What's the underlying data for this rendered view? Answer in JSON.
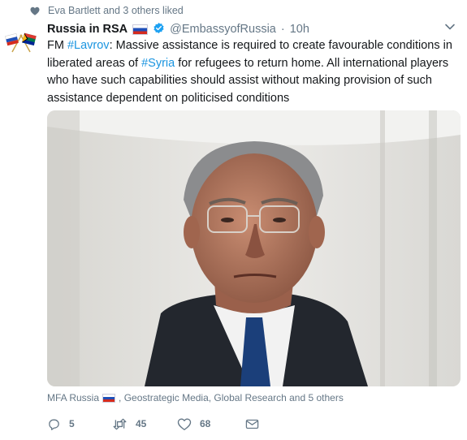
{
  "social_context": {
    "text": "Eva Bartlett and 3 others liked"
  },
  "tweet": {
    "display_name": "Russia in RSA",
    "handle": "@EmbassyofRussia",
    "separator": "·",
    "time": "10h",
    "text_parts": [
      {
        "text": "FM ",
        "type": "plain"
      },
      {
        "text": "#Lavrov",
        "type": "hashtag"
      },
      {
        "text": ": Massive assistance is required to create favourable conditions in liberated areas of ",
        "type": "plain"
      },
      {
        "text": "#Syria",
        "type": "hashtag"
      },
      {
        "text": " for refugees to return home. All international players who have such capabilities should assist without making provision of such assistance dependent on politicised conditions",
        "type": "plain"
      }
    ]
  },
  "likers": {
    "first": "MFA Russia",
    "rest": ", Geostrategic Media, Global Research and 5 others"
  },
  "actions": {
    "reply_count": "5",
    "retweet_count": "45",
    "like_count": "68"
  },
  "colors": {
    "link": "#1b95e0",
    "secondary_text": "#657786",
    "verified": "#1da1f2"
  },
  "icons": {
    "liked": "heart-icon",
    "reply": "reply-icon",
    "retweet": "retweet-icon",
    "like": "heart-outline-icon",
    "dm": "envelope-icon",
    "more": "chevron-down-icon"
  }
}
